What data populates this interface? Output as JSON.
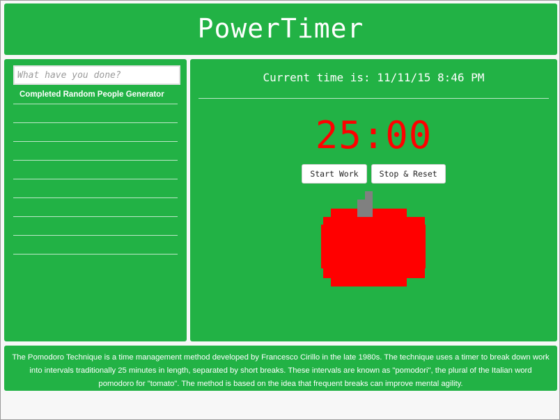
{
  "colors": {
    "panel_green": "#22b245",
    "timer_red": "#ff0000",
    "stem_gray": "#808080"
  },
  "header": {
    "title": "PowerTimer"
  },
  "sidebar": {
    "input_placeholder": "What have you done?",
    "input_value": "",
    "tasks": [
      "Completed Random People Generator",
      "",
      "",
      "",
      "",
      "",
      "",
      "",
      ""
    ]
  },
  "main": {
    "current_time": "Current time is: 11/11/15 8:46 PM",
    "timer": "25:00",
    "start_label": "Start Work",
    "stop_label": "Stop & Reset",
    "image": "tomato-pixel-icon"
  },
  "footer": {
    "description": "The Pomodoro Technique is a time management method developed by Francesco Cirillo in the late 1980s. The technique uses a timer to break down work into intervals traditionally 25 minutes in length, separated by short breaks. These intervals are known as \"pomodori\", the plural of the Italian word pomodoro for \"tomato\". The method is based on the idea that frequent breaks can improve mental agility."
  }
}
